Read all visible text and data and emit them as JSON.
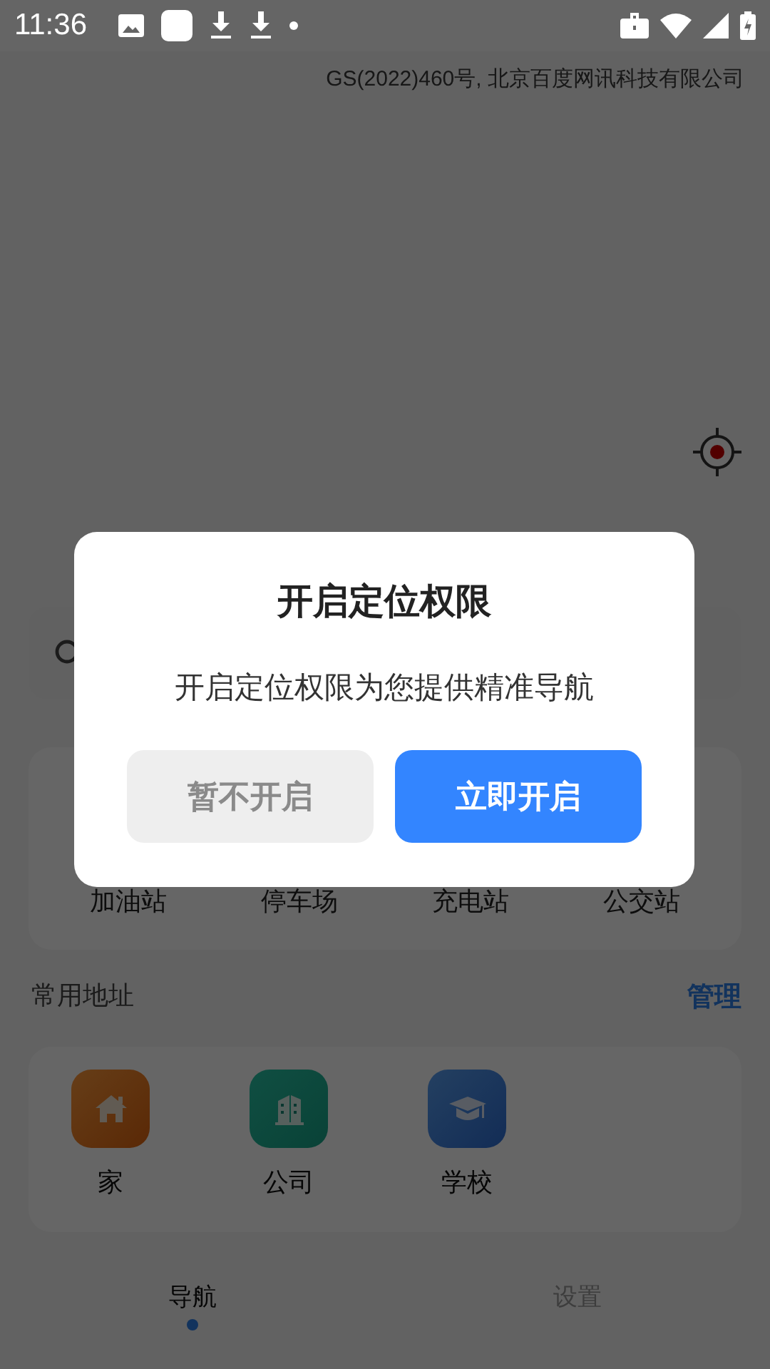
{
  "status_bar": {
    "time": "11:36"
  },
  "map": {
    "copyright": "GS(2022)460号, 北京百度网讯科技有限公司"
  },
  "categories": [
    {
      "label": "加油站"
    },
    {
      "label": "停车场"
    },
    {
      "label": "充电站"
    },
    {
      "label": "公交站"
    }
  ],
  "common_addresses": {
    "title": "常用地址",
    "action": "管理",
    "items": [
      {
        "label": "家",
        "kind": "home"
      },
      {
        "label": "公司",
        "kind": "company"
      },
      {
        "label": "学校",
        "kind": "school"
      }
    ]
  },
  "tabs": [
    {
      "label": "导航",
      "selected": true
    },
    {
      "label": "设置",
      "selected": false
    }
  ],
  "dialog": {
    "title": "开启定位权限",
    "message": "开启定位权限为您提供精准导航",
    "buttons": [
      {
        "label": "暂不开启",
        "kind": "secondary"
      },
      {
        "label": "立即开启",
        "kind": "primary"
      }
    ]
  }
}
